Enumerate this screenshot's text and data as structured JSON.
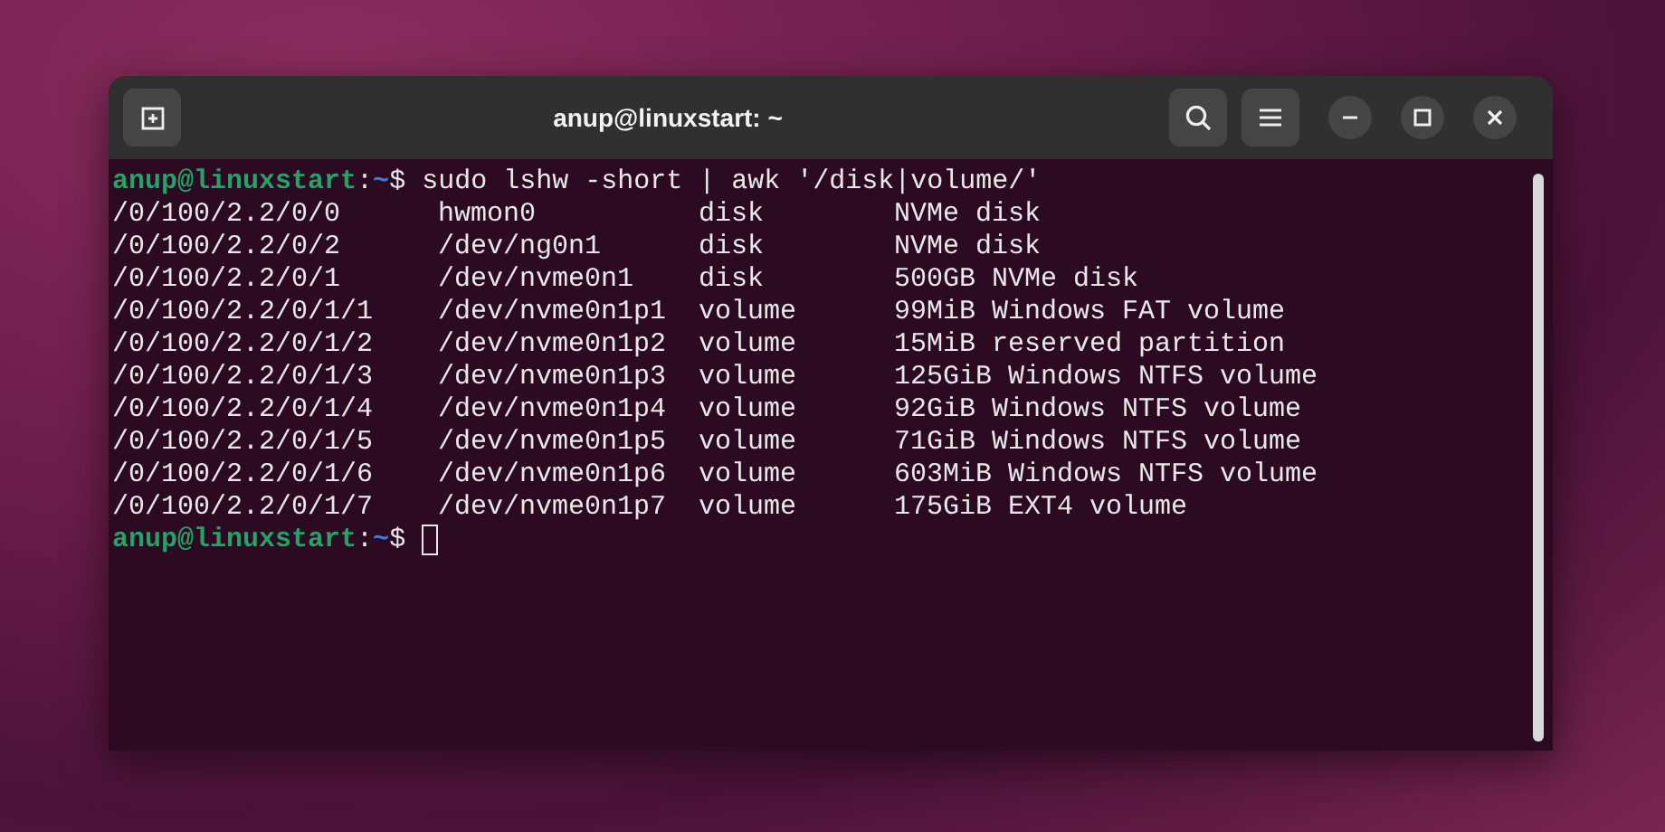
{
  "window": {
    "title": "anup@linuxstart: ~"
  },
  "terminal": {
    "lines": [
      {
        "kind": "prompt",
        "user_host": "anup@linuxstart",
        "separator": ":",
        "path": "~",
        "symbol": "$",
        "command": "sudo lshw -short | awk '/disk|volume/'"
      },
      {
        "kind": "output",
        "cells": [
          "/0/100/2.2/0/0",
          "hwmon0",
          "disk",
          "NVMe disk"
        ]
      },
      {
        "kind": "output",
        "cells": [
          "/0/100/2.2/0/2",
          "/dev/ng0n1",
          "disk",
          "NVMe disk"
        ]
      },
      {
        "kind": "output",
        "cells": [
          "/0/100/2.2/0/1",
          "/dev/nvme0n1",
          "disk",
          "500GB NVMe disk"
        ]
      },
      {
        "kind": "output",
        "cells": [
          "/0/100/2.2/0/1/1",
          "/dev/nvme0n1p1",
          "volume",
          "99MiB Windows FAT volume"
        ]
      },
      {
        "kind": "output",
        "cells": [
          "/0/100/2.2/0/1/2",
          "/dev/nvme0n1p2",
          "volume",
          "15MiB reserved partition"
        ]
      },
      {
        "kind": "output",
        "cells": [
          "/0/100/2.2/0/1/3",
          "/dev/nvme0n1p3",
          "volume",
          "125GiB Windows NTFS volume"
        ]
      },
      {
        "kind": "output",
        "cells": [
          "/0/100/2.2/0/1/4",
          "/dev/nvme0n1p4",
          "volume",
          "92GiB Windows NTFS volume"
        ]
      },
      {
        "kind": "output",
        "cells": [
          "/0/100/2.2/0/1/5",
          "/dev/nvme0n1p5",
          "volume",
          "71GiB Windows NTFS volume"
        ]
      },
      {
        "kind": "output",
        "cells": [
          "/0/100/2.2/0/1/6",
          "/dev/nvme0n1p6",
          "volume",
          "603MiB Windows NTFS volume"
        ]
      },
      {
        "kind": "output",
        "cells": [
          "/0/100/2.2/0/1/7",
          "/dev/nvme0n1p7",
          "volume",
          "175GiB EXT4 volume"
        ]
      },
      {
        "kind": "prompt",
        "user_host": "anup@linuxstart",
        "separator": ":",
        "path": "~",
        "symbol": "$",
        "cursor": true
      }
    ]
  }
}
